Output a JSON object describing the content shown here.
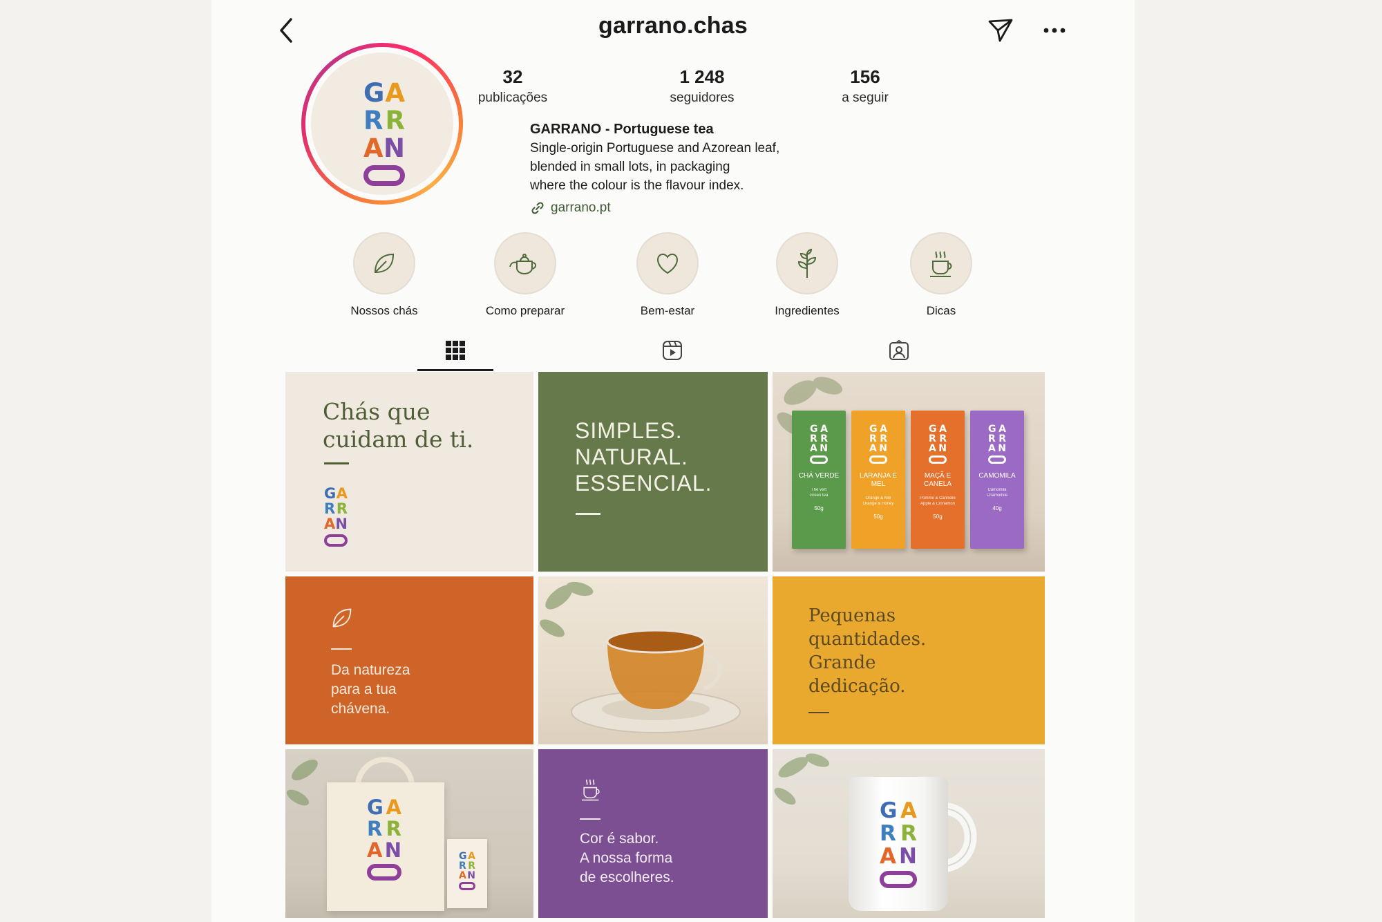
{
  "header": {
    "username": "garrano.chas"
  },
  "stats": [
    {
      "value": "32",
      "label": "publicações"
    },
    {
      "value": "1 248",
      "label": "seguidores"
    },
    {
      "value": "156",
      "label": "a seguir"
    }
  ],
  "bio": {
    "name": "GARRANO - Portuguese tea",
    "lines": [
      "Single-origin Portuguese and Azorean leaf,",
      "blended in small lots, in packaging",
      "where the colour is the flavour index."
    ],
    "link": "garrano.pt"
  },
  "highlights": [
    {
      "label": "Nossos chás",
      "icon": "leaf-icon"
    },
    {
      "label": "Como preparar",
      "icon": "teapot-icon"
    },
    {
      "label": "Bem-estar",
      "icon": "heart-icon"
    },
    {
      "label": "Ingredientes",
      "icon": "sprig-icon"
    },
    {
      "label": "Dicas",
      "icon": "steaming-cup-icon"
    }
  ],
  "tabs": [
    {
      "icon": "grid-icon",
      "active": true
    },
    {
      "icon": "reels-icon",
      "active": false
    },
    {
      "icon": "tagged-icon",
      "active": false
    }
  ],
  "brand": {
    "letters": [
      [
        "G",
        "A"
      ],
      [
        "R",
        "R"
      ],
      [
        "A",
        "N"
      ]
    ],
    "colors": {
      "G": "#3f6db3",
      "A1": "#e99a1e",
      "R1": "#3f7fc0",
      "R2": "#8bb33a",
      "A2": "#e2672a",
      "N": "#7b4fa8",
      "pill": "#8e3f9a"
    }
  },
  "posts": {
    "p1": {
      "line1": "Chás que",
      "line2": "cuidam de ti.",
      "bg": "#f0e9e0",
      "text_color": "#4f5e36"
    },
    "p2": {
      "line1": "SIMPLES.",
      "line2": "NATURAL.",
      "line3": "ESSENCIAL.",
      "bg": "#66794a"
    },
    "p3": {
      "boxes": [
        {
          "name": "CHÁ VERDE",
          "sub1": "Thé vert",
          "sub2": "Green tea",
          "weight": "50g",
          "color": "#5b9a4a"
        },
        {
          "name": "LARANJA E MEL",
          "sub1": "Orange & Mel",
          "sub2": "Orange & Honey",
          "weight": "50g",
          "color": "#f0a128"
        },
        {
          "name": "MAÇÃ E CANELA",
          "sub1": "Pomme & Cannelle",
          "sub2": "Apple & Cinnamon",
          "weight": "50g",
          "color": "#e4702b"
        },
        {
          "name": "CAMOMILA",
          "sub1": "Camomila",
          "sub2": "Chamomile",
          "weight": "40g",
          "color": "#9b6ac4"
        }
      ]
    },
    "p4": {
      "line1": "Da natureza",
      "line2": "para a tua",
      "line3": "chávena.",
      "bg": "#cf6428"
    },
    "p5": {
      "bg": "#ede4d6"
    },
    "p6": {
      "line1": "Pequenas",
      "line2": "quantidades.",
      "line3": "Grande",
      "line4": "dedicação.",
      "bg": "#e9a82e",
      "text_color": "#5b4a24"
    },
    "p7": {
      "bg": "#d9d3c9"
    },
    "p8": {
      "line1": "Cor é sabor.",
      "line2": "A nossa forma",
      "line3": "de escolheres.",
      "bg": "#7c4f93"
    },
    "p9": {
      "bg": "#e6e1d8"
    }
  }
}
